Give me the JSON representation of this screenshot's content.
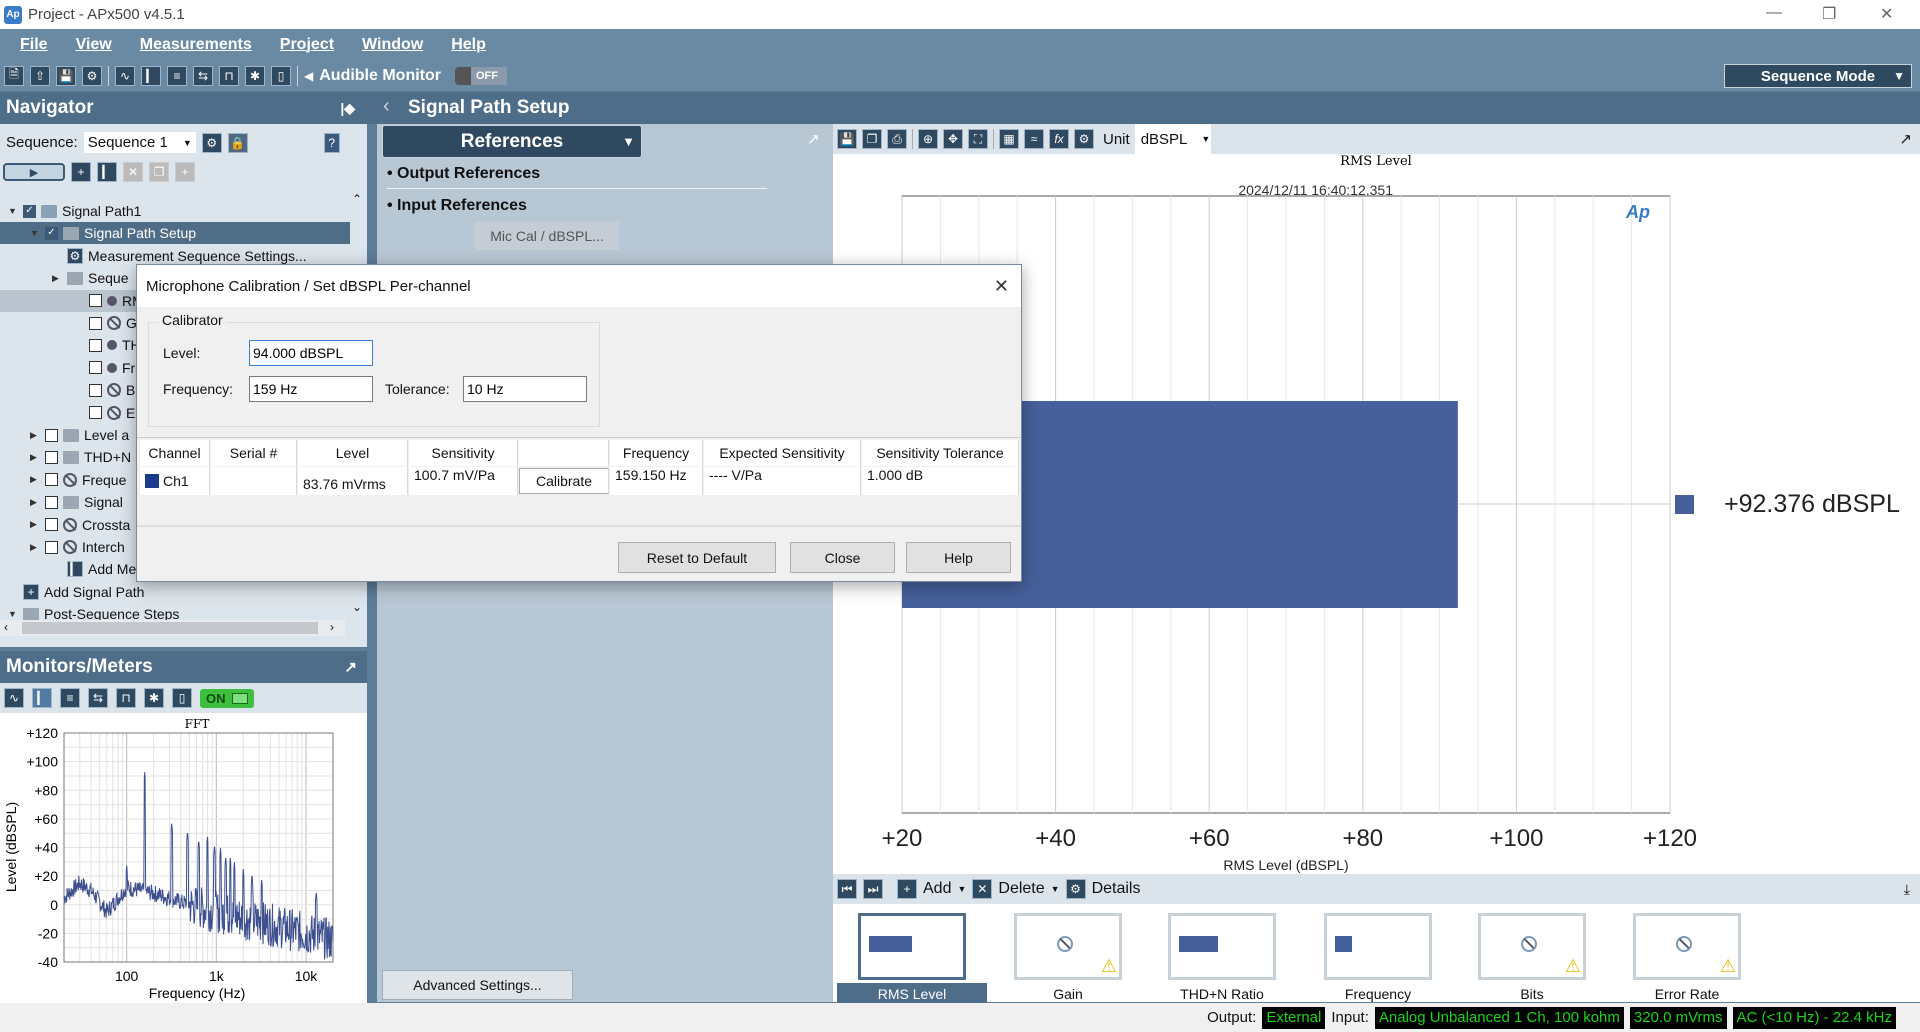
{
  "window": {
    "title": "Project - APx500 v4.5.1",
    "logo": "AP"
  },
  "menu": [
    "File",
    "View",
    "Measurements",
    "Project",
    "Window",
    "Help"
  ],
  "toolbar": {
    "audible_monitor": "Audible Monitor",
    "audible_state": "OFF",
    "sequence_mode": "Sequence Mode"
  },
  "navigator": {
    "title": "Navigator",
    "sequence_label": "Sequence:",
    "sequence_value": "Sequence 1",
    "tree": [
      {
        "label": "Signal Path1",
        "level": 0,
        "icon": "signal-path",
        "checked": true,
        "expand": "open"
      },
      {
        "label": "Signal Path Setup",
        "level": 1,
        "icon": "folder",
        "checked": true,
        "expand": "open",
        "selected": true
      },
      {
        "label": "Measurement Sequence Settings...",
        "level": 2,
        "icon": "gear"
      },
      {
        "label": "Seque",
        "level": 2,
        "icon": "folder",
        "expand": "closed"
      },
      {
        "label": "RM",
        "level": 3,
        "icon": "dot",
        "checked": false,
        "highlight": true
      },
      {
        "label": "Gai",
        "level": 3,
        "icon": "disabled",
        "checked": false
      },
      {
        "label": "THI",
        "level": 3,
        "icon": "dot",
        "checked": false
      },
      {
        "label": "Fre",
        "level": 3,
        "icon": "dot",
        "checked": false
      },
      {
        "label": "Bits",
        "level": 3,
        "icon": "disabled",
        "checked": false
      },
      {
        "label": "Err",
        "level": 3,
        "icon": "disabled",
        "checked": false
      },
      {
        "label": "Level a",
        "level": 1,
        "icon": "folder",
        "checked": false,
        "expand": "closed"
      },
      {
        "label": "THD+N",
        "level": 1,
        "icon": "folder",
        "checked": false,
        "expand": "closed"
      },
      {
        "label": "Freque",
        "level": 1,
        "icon": "disabled",
        "checked": false,
        "expand": "closed"
      },
      {
        "label": "Signal",
        "level": 1,
        "icon": "folder",
        "checked": false,
        "expand": "closed"
      },
      {
        "label": "Crossta",
        "level": 1,
        "icon": "disabled",
        "checked": false,
        "expand": "closed"
      },
      {
        "label": "Interch",
        "level": 1,
        "icon": "disabled",
        "checked": false,
        "expand": "closed"
      },
      {
        "label": "Add Meas",
        "level": 2,
        "icon": "add-measurement"
      },
      {
        "label": "Add Signal Path",
        "level": 0,
        "icon": "add-signal-path"
      },
      {
        "label": "Post-Sequence Steps",
        "level": -1,
        "icon": "folder",
        "expand": "open"
      }
    ]
  },
  "monitors": {
    "title": "Monitors/Meters",
    "state": "ON"
  },
  "signal_path": {
    "title": "Signal Path Setup",
    "dropdown": "References",
    "sections": [
      "Output References",
      "Input References"
    ],
    "mic_cal_button": "Mic Cal / dBSPL...",
    "advanced_button": "Advanced Settings..."
  },
  "graph": {
    "unit_label": "Unit",
    "unit_value": "dBSPL",
    "timestamp": "2024/12/11 16:40:12.351",
    "logo": "AP"
  },
  "chart_data": [
    {
      "type": "bar",
      "title": "RMS Level",
      "xlabel": "RMS Level (dBSPL)",
      "xlim": [
        20,
        120
      ],
      "xticks": [
        "+20",
        "+40",
        "+60",
        "+80",
        "+100",
        "+120"
      ],
      "grid": true,
      "orientation": "horizontal",
      "series": [
        {
          "name": "Ch1",
          "value": 92.376,
          "color": "#46609c"
        }
      ],
      "value_label": "+92.376  dBSPL"
    },
    {
      "type": "line",
      "title": "FFT",
      "xlabel": "Frequency (Hz)",
      "ylabel": "Level (dBSPL)",
      "xscale": "log",
      "xlim": [
        20,
        20000
      ],
      "ylim": [
        -40,
        120
      ],
      "xticks": [
        "100",
        "1k",
        "10k"
      ],
      "yticks": [
        "+120",
        "+100",
        "+80",
        "+60",
        "+40",
        "+20",
        "0",
        "-20",
        "-40"
      ],
      "grid": true,
      "color": "#3d4f8f",
      "peaks": [
        [
          100,
          28
        ],
        [
          159,
          93
        ],
        [
          318,
          58
        ],
        [
          477,
          52
        ],
        [
          636,
          46
        ],
        [
          795,
          48
        ],
        [
          954,
          42
        ],
        [
          1113,
          40
        ],
        [
          1272,
          34
        ],
        [
          1431,
          33
        ],
        [
          1590,
          30
        ],
        [
          2000,
          25
        ],
        [
          2500,
          22
        ],
        [
          3200,
          18
        ],
        [
          13000,
          10
        ]
      ],
      "noise_floor": [
        [
          20,
          5
        ],
        [
          30,
          15
        ],
        [
          40,
          10
        ],
        [
          60,
          -5
        ],
        [
          100,
          12
        ],
        [
          200,
          8
        ],
        [
          500,
          0
        ],
        [
          1000,
          -5
        ],
        [
          3000,
          -12
        ],
        [
          10000,
          -20
        ],
        [
          20000,
          -25
        ]
      ]
    }
  ],
  "results": {
    "nav": {
      "add": "Add",
      "delete": "Delete",
      "details": "Details"
    },
    "items": [
      {
        "label": "RMS Level",
        "selected": true,
        "bar": 0.72
      },
      {
        "label": "Gain",
        "warning": true,
        "disabled": true
      },
      {
        "label": "THD+N Ratio",
        "bar": 0.65
      },
      {
        "label": "Frequency",
        "bar": 0.28
      },
      {
        "label": "Bits",
        "warning": true,
        "disabled": true
      },
      {
        "label": "Error Rate",
        "warning": true,
        "disabled": true
      }
    ]
  },
  "status": {
    "output_label": "Output:",
    "output": "External",
    "input_label": "Input:",
    "input": "Analog Unbalanced 1 Ch, 100 kohm",
    "range": "320.0 mVrms",
    "bandwidth": "AC (<10 Hz) - 22.4 kHz"
  },
  "dialog": {
    "title": "Microphone Calibration / Set dBSPL Per-channel",
    "group": "Calibrator",
    "level_label": "Level:",
    "level": "94.000 dBSPL",
    "frequency_label": "Frequency:",
    "frequency": "159 Hz",
    "tolerance_label": "Tolerance:",
    "tolerance": "10 Hz",
    "columns": [
      "Channel",
      "Serial #",
      "Level",
      "Sensitivity",
      "",
      "Frequency",
      "Expected Sensitivity",
      "Sensitivity Tolerance"
    ],
    "row": {
      "channel": "Ch1",
      "channel_color": "#1a3a8a",
      "serial": "",
      "level": "83.76 mVrms",
      "sensitivity": "100.7 mV/Pa",
      "calibrate": "Calibrate",
      "frequency": "159.150 Hz",
      "expected": "---- V/Pa",
      "tolerance": "1.000 dB"
    },
    "buttons": {
      "reset": "Reset to Default",
      "close": "Close",
      "help": "Help"
    }
  }
}
